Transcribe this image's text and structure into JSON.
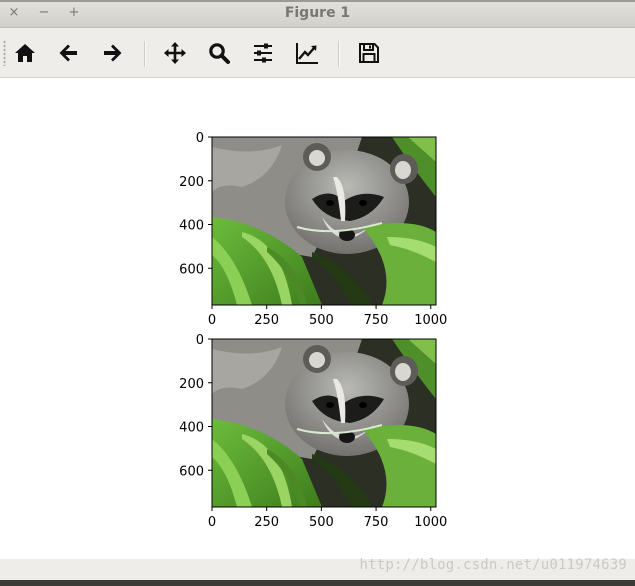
{
  "window": {
    "title": "Figure 1",
    "controls": {
      "close": "×",
      "minimize": "−",
      "maximize": "+"
    }
  },
  "toolbar": {
    "buttons": [
      {
        "icon": "home-icon",
        "tooltip": "Home"
      },
      {
        "icon": "back-arrow-icon",
        "tooltip": "Back"
      },
      {
        "icon": "forward-arrow-icon",
        "tooltip": "Forward"
      },
      {
        "icon": "pan-move-icon",
        "tooltip": "Pan"
      },
      {
        "icon": "zoom-magnifier-icon",
        "tooltip": "Zoom"
      },
      {
        "icon": "subplots-sliders-icon",
        "tooltip": "Subplots"
      },
      {
        "icon": "edit-axis-chart-icon",
        "tooltip": "Customize"
      },
      {
        "icon": "save-floppy-icon",
        "tooltip": "Save"
      }
    ]
  },
  "plots": [
    {
      "image": "raccoon (face) photo",
      "x_ticks": [
        "0",
        "250",
        "500",
        "750",
        "1000"
      ],
      "y_ticks": [
        "0",
        "200",
        "400",
        "600"
      ],
      "xlim": [
        0,
        1024
      ],
      "ylim": [
        768,
        0
      ]
    },
    {
      "image": "raccoon (face) photo",
      "x_ticks": [
        "0",
        "250",
        "500",
        "750",
        "1000"
      ],
      "y_ticks": [
        "0",
        "200",
        "400",
        "600"
      ],
      "xlim": [
        0,
        1024
      ],
      "ylim": [
        768,
        0
      ]
    }
  ],
  "watermark": "http://blog.csdn.net/u011974639",
  "colors": {
    "titlebar": "#d8d6d2",
    "toolbar": "#efedea",
    "icon": "#111111",
    "leaf_green": "#5fa832",
    "raccoon_fur": "#8a8a8a"
  }
}
